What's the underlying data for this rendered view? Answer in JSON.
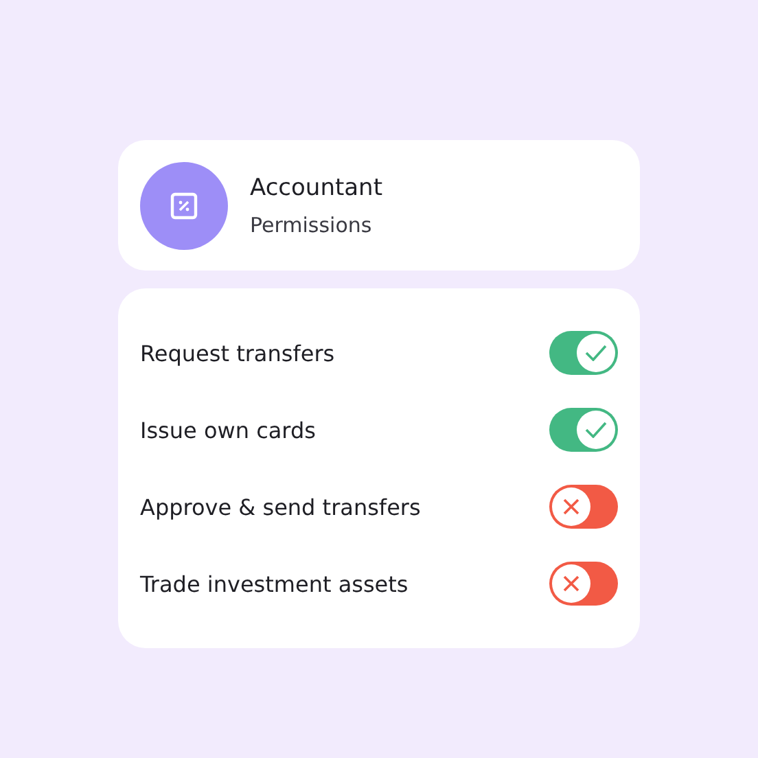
{
  "profile": {
    "title": "Accountant",
    "subtitle": "Permissions"
  },
  "permissions": [
    {
      "label": "Request transfers",
      "on": true
    },
    {
      "label": "Issue own cards",
      "on": true
    },
    {
      "label": "Approve & send transfers",
      "on": false
    },
    {
      "label": "Trade investment assets",
      "on": false
    }
  ]
}
